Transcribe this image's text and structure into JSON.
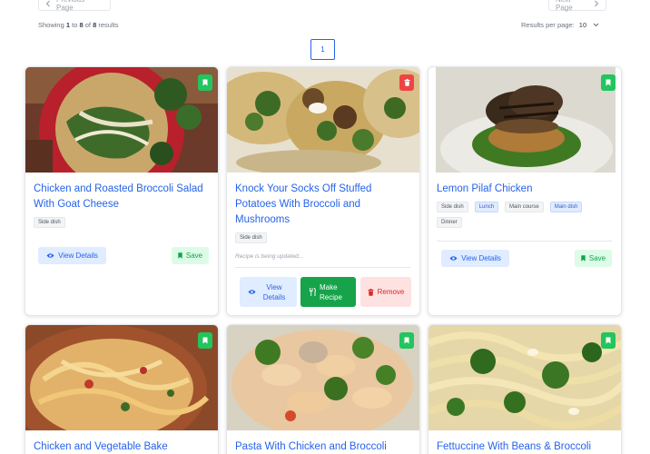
{
  "pagination": {
    "previous_label": "Previous Page",
    "next_label": "Next Page",
    "showing_prefix": "Showing",
    "range_start": "1",
    "to_word": "to",
    "range_end": "8",
    "of_word": "of",
    "total": "8",
    "results_word": "results",
    "per_page_label": "Results per page:",
    "per_page_value": "10",
    "current_page": "1"
  },
  "recipes": [
    {
      "title": "Chicken and Roasted Broccoli Salad With Goat Cheese",
      "tags": [
        "Side dish"
      ],
      "bookmark": "save",
      "actions": {
        "details": "View Details",
        "save": "Save"
      },
      "colors": {
        "bookmark": "#22c55e"
      }
    },
    {
      "title": "Knock Your Socks Off Stuffed Potatoes With Broccoli and Mushrooms",
      "tags": [
        "Side dish"
      ],
      "status": "Recipe is being updated...",
      "bookmark": "remove",
      "actions": {
        "details": "View Details",
        "make": "Make Recipe",
        "remove": "Remove"
      },
      "colors": {
        "bookmark": "#ef4444"
      }
    },
    {
      "title": "Lemon Pilaf Chicken",
      "tags": [
        "Side dish",
        "Lunch",
        "Main course",
        "Main dish",
        "Dinner"
      ],
      "bookmark": "save",
      "actions": {
        "details": "View Details",
        "save": "Save"
      },
      "colors": {
        "bookmark": "#22c55e"
      }
    },
    {
      "title": "Chicken and Vegetable Bake",
      "bookmark": "save"
    },
    {
      "title": "Pasta With Chicken and Broccoli",
      "bookmark": "save"
    },
    {
      "title": "Fettuccine With Beans & Broccoli",
      "bookmark": "save"
    }
  ],
  "icons": {
    "chevron_left": "chevron-left-icon",
    "chevron_right": "chevron-right-icon",
    "eye": "eye-icon",
    "bookmark": "bookmark-icon",
    "trash": "trash-icon",
    "utensils": "utensils-icon"
  },
  "colors": {
    "accent": "#2563eb",
    "save_green": "#16a34a",
    "remove_red": "#dc2626"
  }
}
